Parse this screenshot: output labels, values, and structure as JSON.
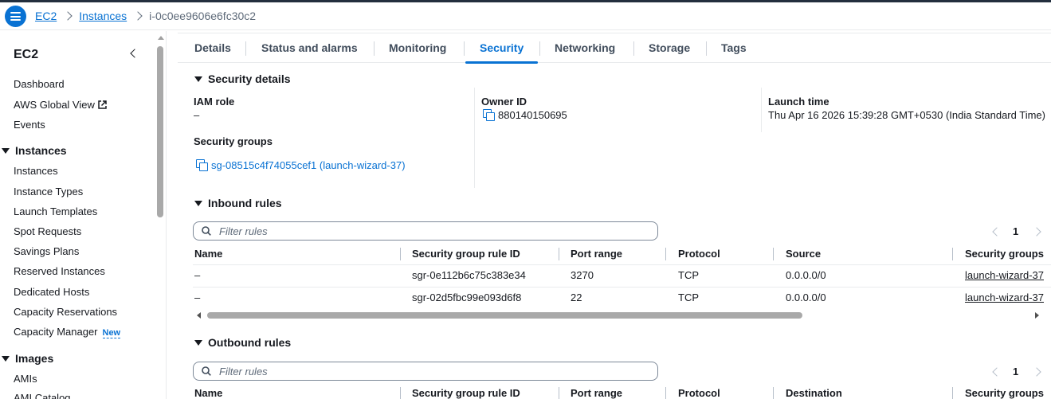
{
  "breadcrumbs": {
    "root": "EC2",
    "section": "Instances",
    "current": "i-0c0ee9606e6fc30c2"
  },
  "sidebar": {
    "title": "EC2",
    "top_items": [
      "Dashboard",
      "AWS Global View",
      "Events"
    ],
    "instances_section": "Instances",
    "instances_items": [
      "Instances",
      "Instance Types",
      "Launch Templates",
      "Spot Requests",
      "Savings Plans",
      "Reserved Instances",
      "Dedicated Hosts",
      "Capacity Reservations",
      "Capacity Manager"
    ],
    "new_badge": "New",
    "images_section": "Images",
    "images_items": [
      "AMIs",
      "AMI Catalog"
    ]
  },
  "tabs": [
    "Details",
    "Status and alarms",
    "Monitoring",
    "Security",
    "Networking",
    "Storage",
    "Tags"
  ],
  "active_tab": "Security",
  "security_details": {
    "heading": "Security details",
    "iam_role_label": "IAM role",
    "iam_role_value": "–",
    "owner_id_label": "Owner ID",
    "owner_id_value": "880140150695",
    "launch_time_label": "Launch time",
    "launch_time_value": "Thu Apr 16 2026 15:39:28 GMT+0530 (India Standard Time)",
    "security_groups_label": "Security groups",
    "security_group_link": "sg-08515c4f74055cef1 (launch-wizard-37)"
  },
  "inbound": {
    "heading": "Inbound rules",
    "filter_placeholder": "Filter rules",
    "page": "1",
    "columns": [
      "Name",
      "Security group rule ID",
      "Port range",
      "Protocol",
      "Source",
      "Security groups"
    ],
    "rows": [
      {
        "name": "–",
        "rule_id": "sgr-0e112b6c75c383e34",
        "port_range": "3270",
        "protocol": "TCP",
        "source": "0.0.0.0/0",
        "security_group": "launch-wizard-37"
      },
      {
        "name": "–",
        "rule_id": "sgr-02d5fbc99e093d6f8",
        "port_range": "22",
        "protocol": "TCP",
        "source": "0.0.0.0/0",
        "security_group": "launch-wizard-37"
      }
    ]
  },
  "outbound": {
    "heading": "Outbound rules",
    "filter_placeholder": "Filter rules",
    "page": "1",
    "columns": [
      "Name",
      "Security group rule ID",
      "Port range",
      "Protocol",
      "Destination",
      "Security groups"
    ]
  },
  "colors": {
    "accent": "#0972d3",
    "text": "#16191f",
    "header_dark": "#232f3e"
  },
  "icons": {
    "menu": "hamburger-icon",
    "collapse": "chevron-left-icon",
    "external": "external-link-icon",
    "copy": "copy-icon",
    "search": "search-icon"
  }
}
